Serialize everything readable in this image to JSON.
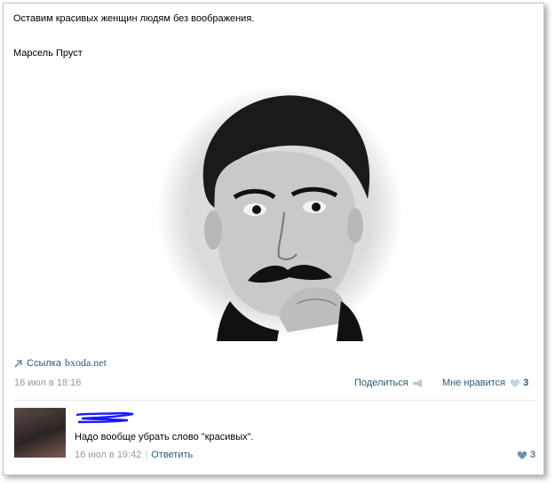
{
  "post": {
    "text": "Оставим красивых женщин людям без воображения.",
    "author": "Марсель Пруст",
    "link_label": "Ссылка",
    "link_domain": "bxoda.net",
    "date": "16 июл в 18:16",
    "share_label": "Поделиться",
    "like_label": "Мне нравится",
    "like_count": "3"
  },
  "comment": {
    "text": "Надо вообще убрать слово \"красивых\".",
    "date": "16 июл в 19:42",
    "reply_label": "Ответить",
    "like_count": "3"
  },
  "colors": {
    "link": "#2b587a",
    "meta": "#999999",
    "scribble": "#1a1aff"
  },
  "icons": {
    "link": "arrow-icon",
    "share": "megaphone-icon",
    "like": "heart-icon"
  }
}
